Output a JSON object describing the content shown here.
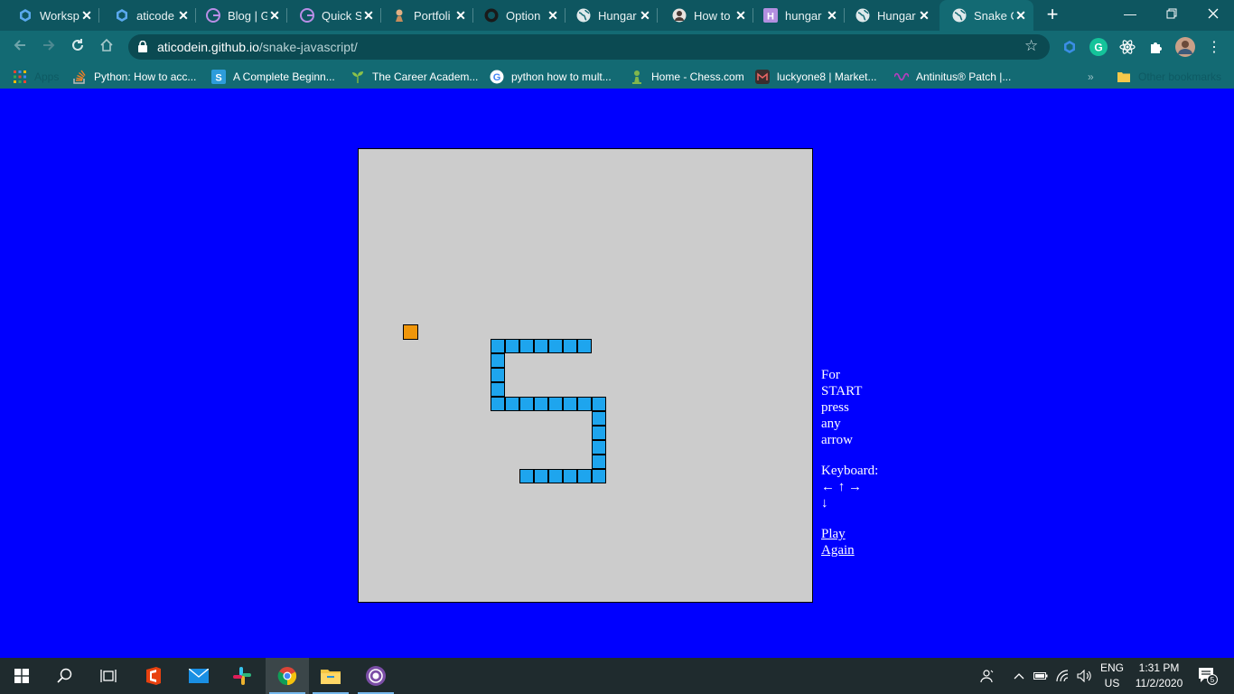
{
  "browser": {
    "tabs": [
      {
        "title": "Worksp",
        "icon": "cube-icon"
      },
      {
        "title": "aticode",
        "icon": "cube-icon"
      },
      {
        "title": "Blog | G",
        "icon": "gatsby-icon"
      },
      {
        "title": "Quick S",
        "icon": "gatsby-icon"
      },
      {
        "title": "Portfoli",
        "icon": "person-icon"
      },
      {
        "title": "Option",
        "icon": "github-icon"
      },
      {
        "title": "Hungar",
        "icon": "globe-icon"
      },
      {
        "title": "How to",
        "icon": "avatar-icon"
      },
      {
        "title": "hungar",
        "icon": "hashnode-icon"
      },
      {
        "title": "Hungar",
        "icon": "globe-icon"
      },
      {
        "title": "Snake G",
        "icon": "globe-icon",
        "active": true
      }
    ],
    "url_domain": "aticodein.github.io",
    "url_path": "/snake-javascript/",
    "bookmarks": [
      {
        "label": "Apps",
        "icon": "apps-grid-icon"
      },
      {
        "label": "Python: How to acc...",
        "icon": "stackoverflow-icon"
      },
      {
        "label": "A Complete Beginn...",
        "icon": "s-icon"
      },
      {
        "label": "The Career Academ...",
        "icon": "sprout-icon"
      },
      {
        "label": "python how to mult...",
        "icon": "google-icon"
      },
      {
        "label": "Home - Chess.com",
        "icon": "pawn-icon"
      },
      {
        "label": "luckyone8 | Market...",
        "icon": "market-icon"
      },
      {
        "label": "Antinitus® Patch |...",
        "icon": "wave-icon"
      }
    ],
    "other_bookmarks": "Other bookmarks",
    "colors": {
      "tab_strip": "#0e5660",
      "toolbar": "#136a73"
    }
  },
  "game": {
    "board_color": "#cccccc",
    "snake_color": "#1ea5ee",
    "food_color": "#f0960a",
    "page_background": "#0000ff",
    "instructions": [
      "For",
      "START",
      "press",
      "any",
      "arrow"
    ],
    "keyboard_label": "Keyboard:",
    "arrow_keys": "← ↑ →",
    "arrow_down": "↓",
    "play_again": [
      "Play",
      "Again"
    ]
  },
  "taskbar": {
    "apps": [
      "windows-start-icon",
      "search-icon",
      "task-view-icon",
      "office-icon",
      "mail-icon",
      "slack-icon",
      "chrome-icon",
      "file-explorer-icon",
      "tor-icon"
    ],
    "language": "ENG",
    "region": "US",
    "time": "1:31 PM",
    "date": "11/2/2020",
    "notification_count": "5"
  }
}
